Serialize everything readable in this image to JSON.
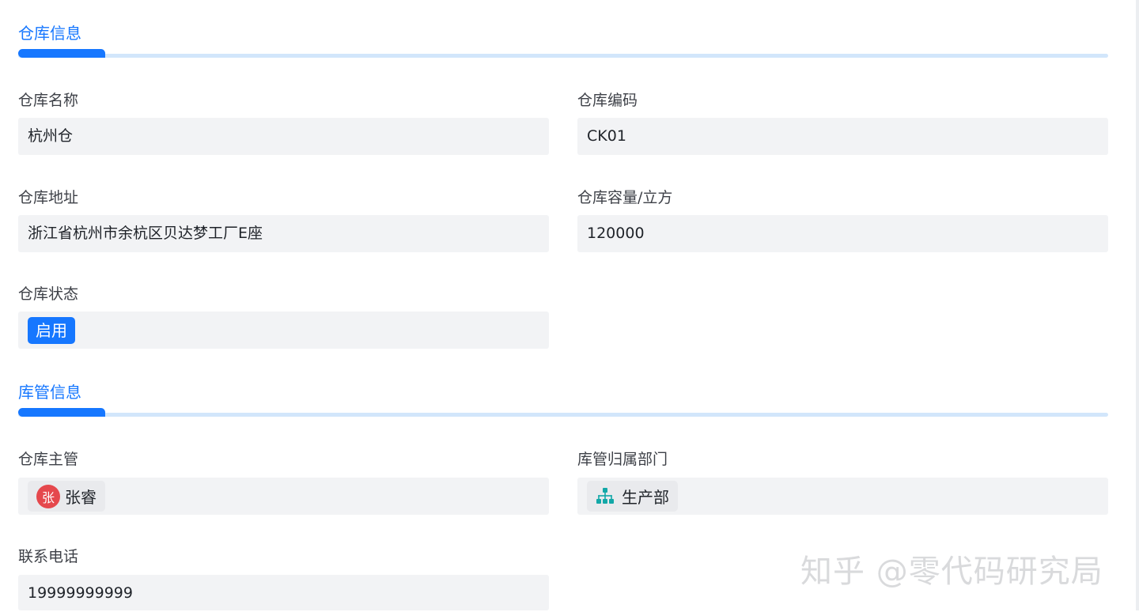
{
  "sections": {
    "warehouse_info": {
      "title": "仓库信息",
      "fields": {
        "name": {
          "label": "仓库名称",
          "value": "杭州仓"
        },
        "code": {
          "label": "仓库编码",
          "value": "CK01"
        },
        "address": {
          "label": "仓库地址",
          "value": "浙江省杭州市余杭区贝达梦工厂E座"
        },
        "capacity": {
          "label": "仓库容量/立方",
          "value": "120000"
        },
        "status": {
          "label": "仓库状态",
          "value": "启用"
        }
      }
    },
    "keeper_info": {
      "title": "库管信息",
      "fields": {
        "manager": {
          "label": "仓库主管",
          "value": "张睿",
          "avatar_text": "张"
        },
        "department": {
          "label": "库管归属部门",
          "value": "生产部",
          "icon": "org-chart-icon"
        },
        "phone": {
          "label": "联系电话",
          "value": "19999999999"
        }
      }
    }
  },
  "watermark": "知乎 @零代码研究局",
  "colors": {
    "accent": "#1677ff",
    "accent_light": "#d2e6fb",
    "field_bg": "#f2f3f5",
    "avatar_bg": "#e5484d",
    "org_icon": "#13a8a8"
  }
}
